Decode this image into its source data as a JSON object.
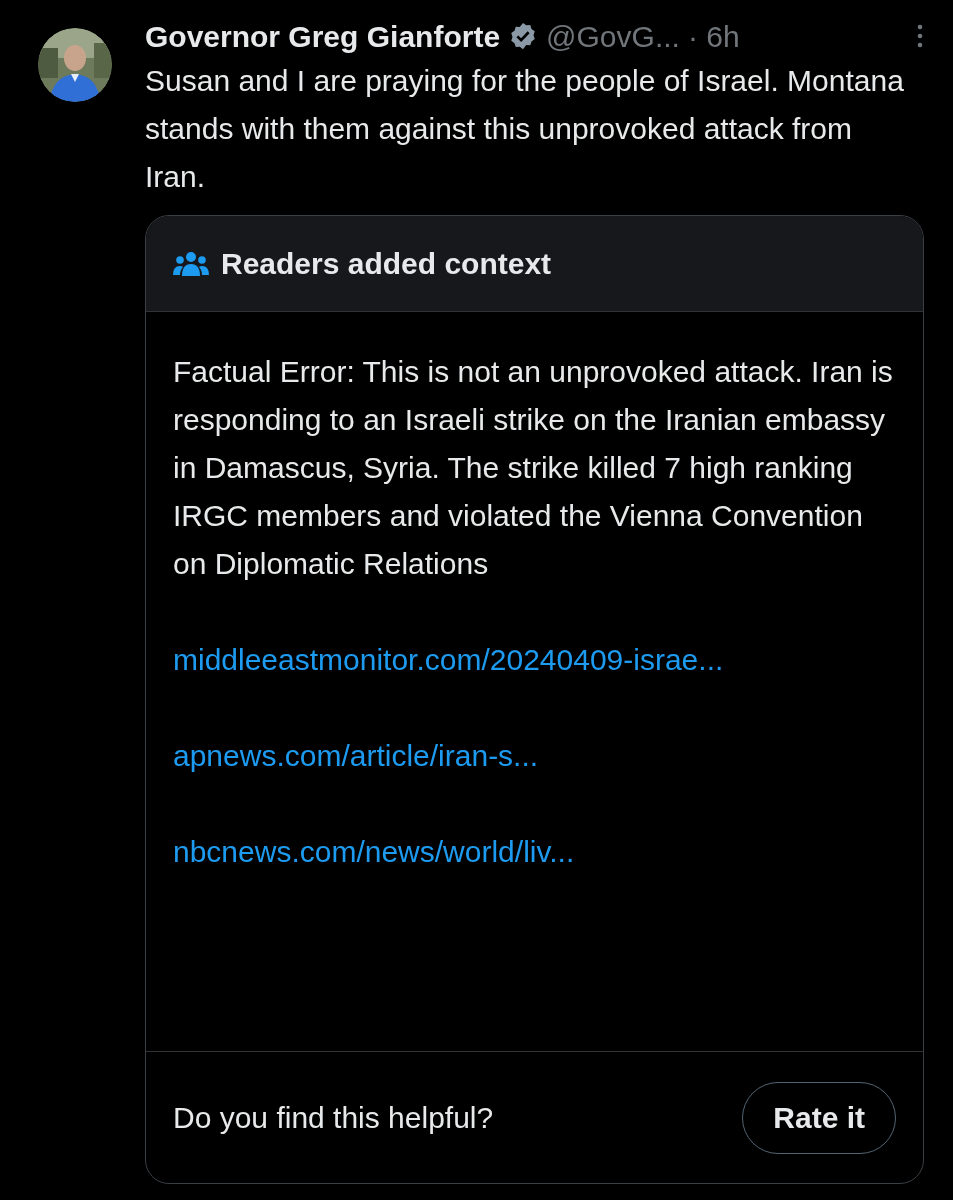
{
  "post": {
    "author": "Governor Greg Gianforte",
    "verified": true,
    "handle": "@GovG...",
    "time": "· 6h",
    "text": "Susan and I are praying for the people of Israel. Montana stands with them against this unprovoked attack from Iran."
  },
  "note": {
    "title": "Readers added context",
    "body": "Factual Error: This is not an unprovoked attack. Iran is responding to an Israeli strike on the Iranian embassy in Damascus, Syria. The strike killed 7 high ranking IRGC members and violated the Vienna Convention on Diplomatic Relations",
    "links": [
      "middleeastmonitor.com/20240409-israe...",
      "apnews.com/article/iran-s...",
      "nbcnews.com/news/world/liv..."
    ],
    "question": "Do you find this helpful?",
    "button": "Rate it"
  }
}
